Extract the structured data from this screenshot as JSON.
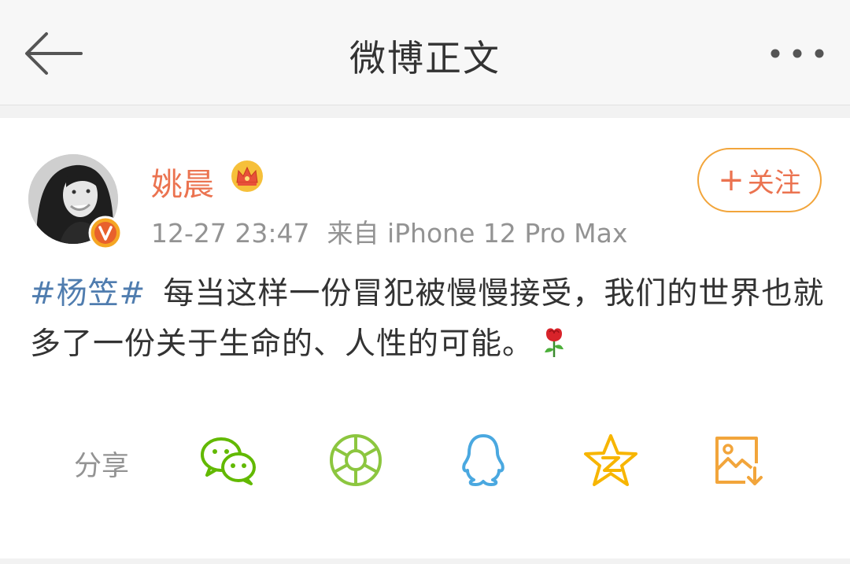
{
  "header": {
    "title": "微博正文"
  },
  "post": {
    "author": "姚晨",
    "timestamp": "12-27 23:47",
    "source": "来自 iPhone 12 Pro Max",
    "follow_label": "关注",
    "follow_plus": "+",
    "topic": "#杨笠#",
    "body": "每当这样一份冒犯被慢慢接受，我们的世界也就多了一份关于生命的、人性的可能。",
    "verified_badge_text": "V"
  },
  "share": {
    "label": "分享",
    "targets": [
      {
        "name": "wechat-icon",
        "color": "#62b900"
      },
      {
        "name": "moments-icon",
        "color": "#8cc63f"
      },
      {
        "name": "qq-icon",
        "color": "#4aa8e0"
      },
      {
        "name": "qzone-icon",
        "color": "#f7b500"
      },
      {
        "name": "save-image-icon",
        "color": "#f2a53b"
      }
    ]
  },
  "colors": {
    "accent": "#eb7350",
    "topic": "#507daf",
    "meta": "#939393",
    "text": "#333333"
  }
}
